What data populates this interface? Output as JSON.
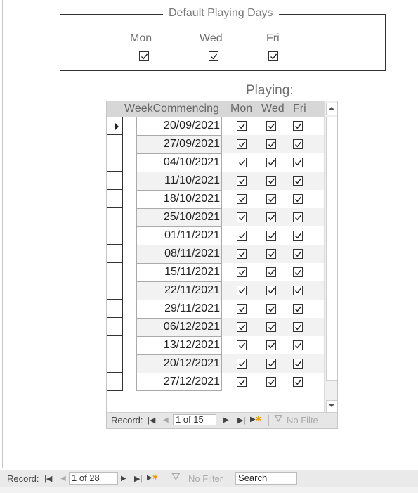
{
  "defaults": {
    "title": "Default Playing Days",
    "days": [
      {
        "label": "Mon",
        "checked": true
      },
      {
        "label": "Wed",
        "checked": true
      },
      {
        "label": "Fri",
        "checked": true
      }
    ]
  },
  "subform": {
    "title": "Playing:",
    "columns": [
      "WeekCommencing",
      "Mon",
      "Wed",
      "Fri"
    ],
    "rows": [
      {
        "date": "20/09/2021",
        "mon": true,
        "wed": true,
        "fri": true
      },
      {
        "date": "27/09/2021",
        "mon": true,
        "wed": true,
        "fri": true
      },
      {
        "date": "04/10/2021",
        "mon": true,
        "wed": true,
        "fri": true
      },
      {
        "date": "11/10/2021",
        "mon": true,
        "wed": true,
        "fri": true
      },
      {
        "date": "18/10/2021",
        "mon": true,
        "wed": true,
        "fri": true
      },
      {
        "date": "25/10/2021",
        "mon": true,
        "wed": true,
        "fri": true
      },
      {
        "date": "01/11/2021",
        "mon": true,
        "wed": true,
        "fri": true
      },
      {
        "date": "08/11/2021",
        "mon": true,
        "wed": true,
        "fri": true
      },
      {
        "date": "15/11/2021",
        "mon": true,
        "wed": true,
        "fri": true
      },
      {
        "date": "22/11/2021",
        "mon": true,
        "wed": true,
        "fri": true
      },
      {
        "date": "29/11/2021",
        "mon": true,
        "wed": true,
        "fri": true
      },
      {
        "date": "06/12/2021",
        "mon": true,
        "wed": true,
        "fri": true
      },
      {
        "date": "13/12/2021",
        "mon": true,
        "wed": true,
        "fri": true
      },
      {
        "date": "20/12/2021",
        "mon": true,
        "wed": true,
        "fri": true
      },
      {
        "date": "27/12/2021",
        "mon": true,
        "wed": true,
        "fri": true
      }
    ],
    "nav": {
      "record_label": "Record:",
      "position": "1 of 15",
      "filter_label": "No Filte"
    }
  },
  "main_nav": {
    "record_label": "Record:",
    "position": "1 of 28",
    "filter_label": "No Filter",
    "search_placeholder": "Search"
  }
}
